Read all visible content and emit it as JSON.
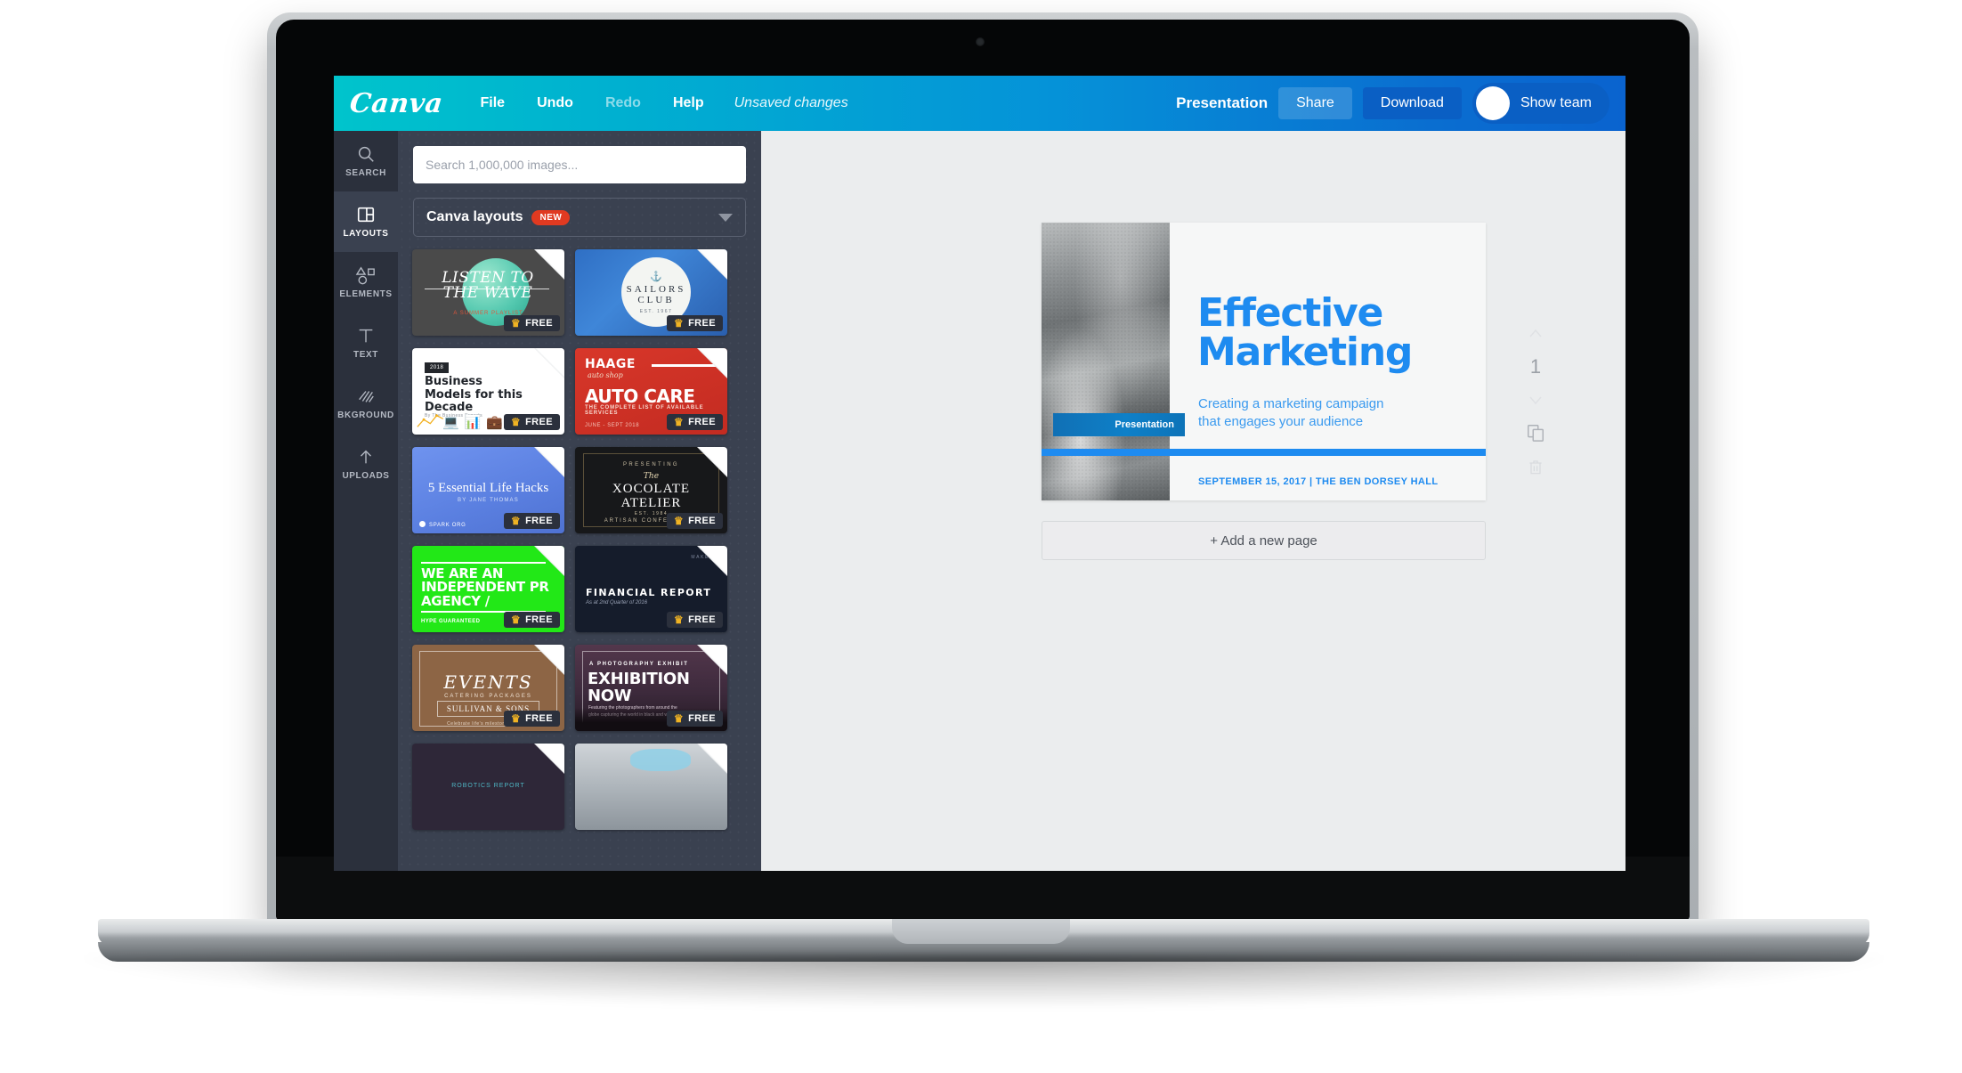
{
  "topbar": {
    "logo": "Canva",
    "menu": [
      {
        "label": "File",
        "dim": false
      },
      {
        "label": "Undo",
        "dim": false
      },
      {
        "label": "Redo",
        "dim": true
      },
      {
        "label": "Help",
        "dim": false
      }
    ],
    "status": "Unsaved changes",
    "doc_title": "Presentation",
    "share_label": "Share",
    "download_label": "Download",
    "team_label": "Show team"
  },
  "rail": {
    "items": [
      {
        "label": "SEARCH",
        "icon": "search-icon",
        "active": false
      },
      {
        "label": "LAYOUTS",
        "icon": "layouts-icon",
        "active": true
      },
      {
        "label": "ELEMENTS",
        "icon": "elements-icon",
        "active": false
      },
      {
        "label": "TEXT",
        "icon": "text-icon",
        "active": false
      },
      {
        "label": "BKGROUND",
        "icon": "background-icon",
        "active": false
      },
      {
        "label": "UPLOADS",
        "icon": "upload-icon",
        "active": false
      }
    ]
  },
  "panel": {
    "search_placeholder": "Search 1,000,000 images...",
    "search_value": "",
    "category_label": "Canva layouts",
    "category_badge": "NEW",
    "free_label": "FREE",
    "templates": [
      {
        "name": "listen-to-the-wave",
        "line1": "LISTEN TO",
        "line2": "THE WAVE",
        "sub": "A SUMMER PLAYLIST"
      },
      {
        "name": "sailors-club",
        "line1": "SAILORS",
        "line2": "CLUB",
        "est": "EST. 1967"
      },
      {
        "name": "business-models",
        "chip": "2018",
        "title": "Business Models for this Decade",
        "by": "By The Business Experts"
      },
      {
        "name": "haage-auto-care",
        "brand": "HAAGE",
        "script": "auto shop",
        "title": "AUTO CARE",
        "sub": "THE COMPLETE LIST OF AVAILABLE SERVICES",
        "date": "JUNE - SEPT 2018"
      },
      {
        "name": "5-essential-life-hacks",
        "title": "5 Essential Life Hacks",
        "sub": "BY JANE THOMAS",
        "brand": "SPARK ORG"
      },
      {
        "name": "xocolate-atelier",
        "presenting": "PRESENTING",
        "the": "The",
        "line1": "XOCOLATE",
        "line2": "ATELIER",
        "est": "EST. 1984",
        "sub": "ARTISAN CONFECTIONS"
      },
      {
        "name": "independent-pr-agency",
        "title": "WE ARE AN INDEPENDENT PR AGENCY /",
        "sub": "HYPE GUARANTEED"
      },
      {
        "name": "financial-report",
        "top": "MAKE",
        "title": "FINANCIAL REPORT",
        "sub": "As at 2nd Quarter of 2016"
      },
      {
        "name": "events-catering",
        "title": "EVENTS",
        "sub": "CATERING PACKAGES",
        "box": "SULLIVAN & SONS",
        "foot": "Celebrate life's milestones with us"
      },
      {
        "name": "exhibition-now",
        "kicker": "A PHOTOGRAPHY EXHIBIT",
        "line1": "EXHIBITION",
        "line2": "NOW",
        "body": "Featuring the photographers from around the globe capturing the world in black and white"
      },
      {
        "name": "robotics-report-partial",
        "text": "ROBOTICS REPORT"
      },
      {
        "name": "landscape-partial",
        "text": ""
      }
    ]
  },
  "slide": {
    "tag": "Presentation",
    "title_line1": "Effective",
    "title_line2": "Marketing",
    "subtitle_line1": "Creating a marketing campaign",
    "subtitle_line2": "that engages your audience",
    "footer": "SEPTEMBER 15, 2017  |  THE BEN DORSEY HALL"
  },
  "canvas": {
    "add_page_label": "+ Add a new page",
    "page_number": "1"
  },
  "page_tools": {
    "move_up": "move-page-up",
    "move_down": "move-page-down",
    "duplicate": "duplicate-page",
    "delete": "delete-page"
  },
  "colors": {
    "brand_teal": "#00c4cc",
    "brand_blue": "#0a63cf",
    "accent_blue": "#1e8bf0",
    "panel_dark": "#3a4150",
    "rail_dark": "#2b303c",
    "badge_red": "#e03a21",
    "crown_gold": "#f0b323"
  }
}
